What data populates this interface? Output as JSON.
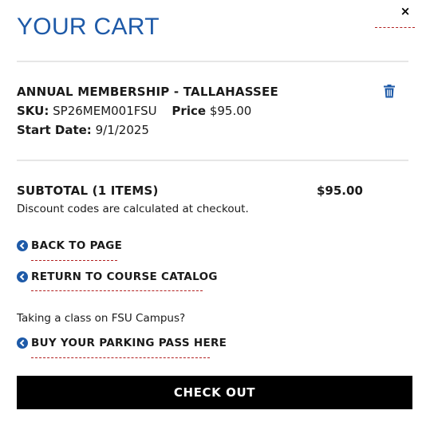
{
  "header": {
    "title": "YOUR CART",
    "close_glyph": "×"
  },
  "cart_item": {
    "name": "ANNUAL MEMBERSHIP - TALLAHASSEE",
    "sku_label": "SKU:",
    "sku_value": "SP26MEM001FSU",
    "price_label": "Price",
    "price_value": "$95.00",
    "start_date_label": "Start Date:",
    "start_date_value": "9/1/2025",
    "remove_icon": "trash-icon"
  },
  "summary": {
    "subtotal_label": "SUBTOTAL (1 ITEMS)",
    "subtotal_value": "$95.00",
    "discount_note": "Discount codes are calculated at checkout."
  },
  "links": {
    "back_to_page": "BACK TO PAGE",
    "return_to_catalog": "RETURN TO COURSE CATALOG",
    "campus_question": "Taking a class on FSU Campus?",
    "parking_pass": "BUY YOUR PARKING PASS HERE"
  },
  "checkout": {
    "label": "CHECK OUT"
  },
  "colors": {
    "accent_blue": "#1e5aa8",
    "checkout_bg": "#000000",
    "link_underline": "#b22222"
  }
}
